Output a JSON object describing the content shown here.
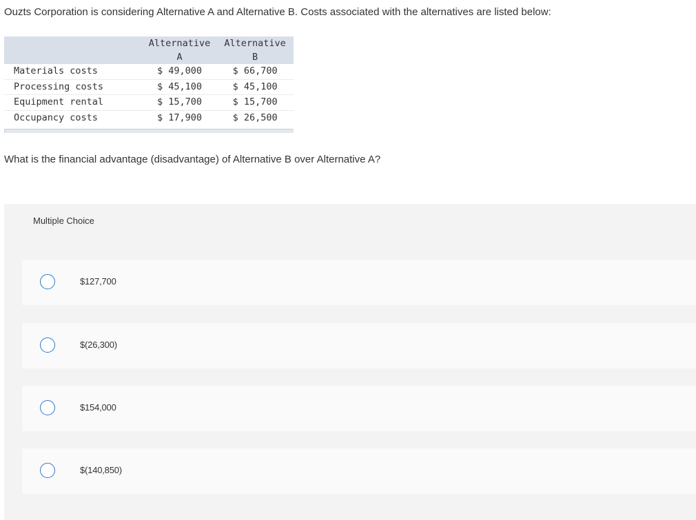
{
  "question": {
    "intro": "Ouzts Corporation is considering Alternative A and Alternative B. Costs associated with the alternatives are listed below:",
    "prompt": "What is the financial advantage (disadvantage) of Alternative B over Alternative A?"
  },
  "cost_table": {
    "headers": {
      "alt_a_line1": "Alternative",
      "alt_a_line2": "A",
      "alt_b_line1": "Alternative",
      "alt_b_line2": "B"
    },
    "rows": [
      {
        "label": "Materials costs",
        "alt_a": "$ 49,000",
        "alt_b": "$ 66,700"
      },
      {
        "label": "Processing costs",
        "alt_a": "$ 45,100",
        "alt_b": "$ 45,100"
      },
      {
        "label": "Equipment rental",
        "alt_a": "$ 15,700",
        "alt_b": "$ 15,700"
      },
      {
        "label": "Occupancy costs",
        "alt_a": "$ 17,900",
        "alt_b": "$ 26,500"
      }
    ]
  },
  "multiple_choice": {
    "header": "Multiple Choice",
    "options": [
      {
        "label": "$127,700"
      },
      {
        "label": "$(26,300)"
      },
      {
        "label": "$154,000"
      },
      {
        "label": "$(140,850)"
      }
    ]
  },
  "colors": {
    "table_header_bg": "#d9dfe9",
    "radio_border": "#2d78c8",
    "panel_bg": "#f3f3f3",
    "option_bg": "#fafafa"
  }
}
